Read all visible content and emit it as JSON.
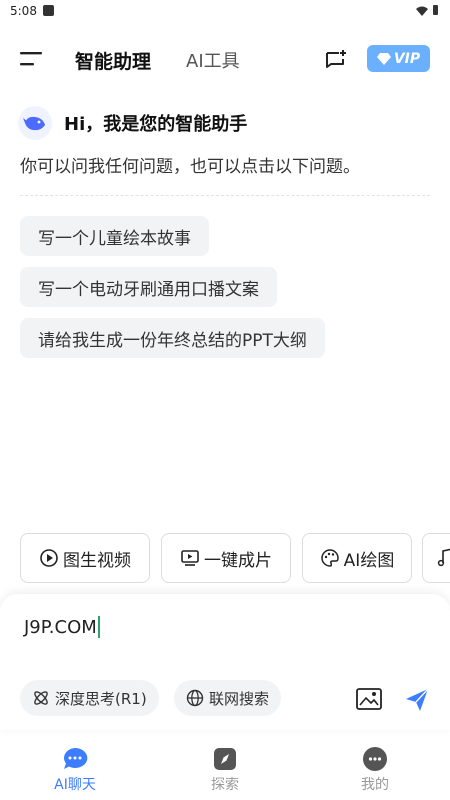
{
  "status_bar": {
    "time": "5:08"
  },
  "header": {
    "tab_active": "智能助理",
    "tab_inactive": "AI工具",
    "vip_label": "VIP"
  },
  "greeting": {
    "title": "Hi，我是您的智能助手",
    "subtitle": "你可以问我任何问题，也可以点击以下问题。"
  },
  "suggestions": [
    "写一个儿童绘本故事",
    "写一个电动牙刷通用口播文案",
    "请给我生成一份年终总结的PPT大纲"
  ],
  "tools": [
    {
      "label": "图生视频",
      "icon": "play-circle-icon"
    },
    {
      "label": "一键成片",
      "icon": "screen-play-icon"
    },
    {
      "label": "AI绘图",
      "icon": "palette-icon"
    },
    {
      "label": "",
      "icon": "music-note-icon"
    }
  ],
  "composer": {
    "input_value": "J9P.COM",
    "chip_deep_think": "深度思考(R1)",
    "chip_web_search": "联网搜索"
  },
  "bottom_nav": [
    {
      "label": "AI聊天",
      "icon": "chat-bubble-icon",
      "active": true
    },
    {
      "label": "探索",
      "icon": "compass-icon",
      "active": false
    },
    {
      "label": "我的",
      "icon": "profile-icon",
      "active": false
    }
  ],
  "colors": {
    "accent": "#3d7dff",
    "vip_bg": "#6bb0ff",
    "chip_bg": "#f2f3f5",
    "inactive_nav": "#999999"
  }
}
